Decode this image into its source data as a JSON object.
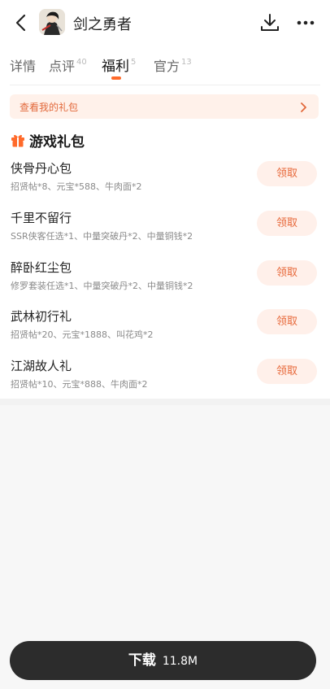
{
  "header": {
    "title": "剑之勇者",
    "back_icon": "chevron-left-icon",
    "download_icon": "download-icon",
    "more_icon": "more-dots-icon"
  },
  "tabs": [
    {
      "label": "详情",
      "count": ""
    },
    {
      "label": "点评",
      "count": "40"
    },
    {
      "label": "福利",
      "count": "5",
      "active": true
    },
    {
      "label": "官方",
      "count": "13"
    }
  ],
  "my_gifts": {
    "label": "查看我的礼包"
  },
  "section": {
    "title": "游戏礼包",
    "icon": "gift-icon"
  },
  "gifts": [
    {
      "name": "侠骨丹心包",
      "desc": "招贤帖*8、元宝*588、牛肉面*2",
      "button": "领取"
    },
    {
      "name": "千里不留行",
      "desc": "SSR侠客任选*1、中量突破丹*2、中量铜钱*2",
      "button": "领取"
    },
    {
      "name": "醉卧红尘包",
      "desc": "修罗套装任选*1、中量突破丹*2、中量铜钱*2",
      "button": "领取"
    },
    {
      "name": "武林初行礼",
      "desc": "招贤帖*20、元宝*1888、叫花鸡*2",
      "button": "领取"
    },
    {
      "name": "江湖故人礼",
      "desc": "招贤帖*10、元宝*888、牛肉面*2",
      "button": "领取"
    }
  ],
  "bottom": {
    "label": "下载",
    "size": "11.8M"
  },
  "colors": {
    "accent": "#ff6a2a",
    "button_bg": "#fff0ea",
    "button_text": "#e7683a",
    "download_bg": "#2c2c2c"
  }
}
